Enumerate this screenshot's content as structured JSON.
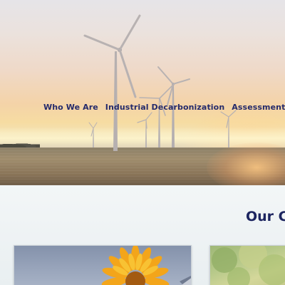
{
  "nav": {
    "items": [
      {
        "label": "Who We Are"
      },
      {
        "label": "Industrial Decarbonization"
      },
      {
        "label": "Assessment & Evalu"
      }
    ]
  },
  "hero": {
    "image": "wind-turbines-sunset-field"
  },
  "section": {
    "title": "Our C"
  },
  "cards": [
    {
      "image": "sunflower-solar-panel"
    },
    {
      "image": "green-foliage"
    }
  ],
  "colors": {
    "nav_text": "#252a6b",
    "heading": "#1d2560",
    "section_bg": "#eef2f4"
  }
}
